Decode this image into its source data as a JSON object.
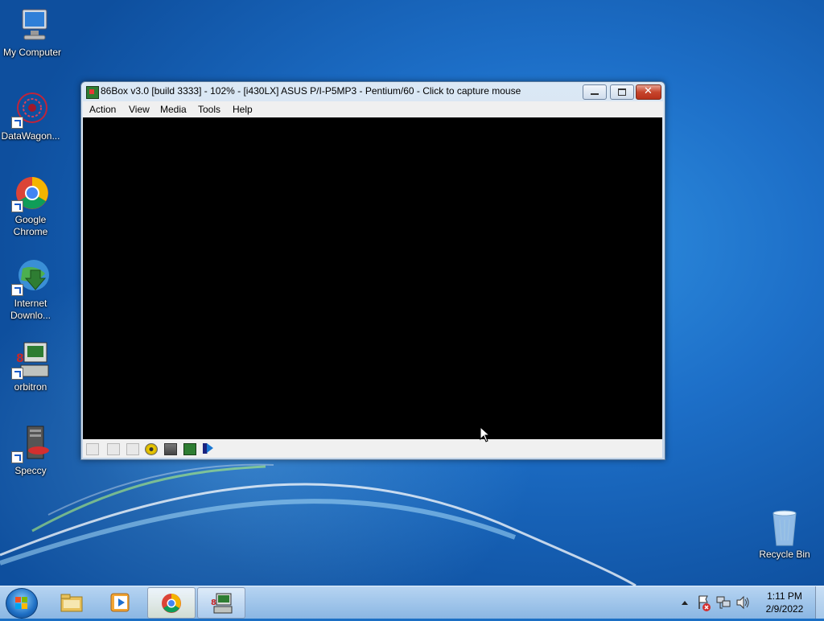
{
  "desktop": {
    "icons": [
      {
        "label": "My Computer",
        "icon": "computer-icon"
      },
      {
        "label": "DataWagon...",
        "icon": "datawagon-icon"
      },
      {
        "label": "Google Chrome",
        "icon": "chrome-icon"
      },
      {
        "label": "Internet Downlo...",
        "icon": "internet-download-manager-icon"
      },
      {
        "label": "orbitron",
        "icon": "orbitron-icon"
      },
      {
        "label": "Speccy",
        "icon": "speccy-icon"
      },
      {
        "label": "Recycle Bin",
        "icon": "recycle-bin-icon"
      }
    ]
  },
  "window": {
    "title": "86Box v3.0 [build 3333] - 102% - [i430LX] ASUS P/I-P5MP3 - Pentium/60 - Click to capture mouse",
    "close_glyph": "✕",
    "menu": [
      "Action",
      "View",
      "Media",
      "Tools",
      "Help"
    ],
    "statusbar_icons": [
      "cassette-icon",
      "floppy-drive-1-icon",
      "floppy-drive-2-icon",
      "cdrom-icon",
      "hard-disk-icon",
      "network-icon",
      "sound-icon"
    ]
  },
  "taskbar": {
    "pinned": [
      "windows-explorer-icon",
      "media-player-icon",
      "chrome-icon",
      "86box-icon"
    ],
    "clock": {
      "time": "1:11 PM",
      "date": "2/9/2022"
    },
    "tray_icons": [
      "show-hidden-icons-icon",
      "action-center-icon",
      "network-tray-icon",
      "volume-icon"
    ]
  },
  "colors": {
    "vm_screen": "#000000",
    "wallpaper": "#1d6fc8"
  }
}
